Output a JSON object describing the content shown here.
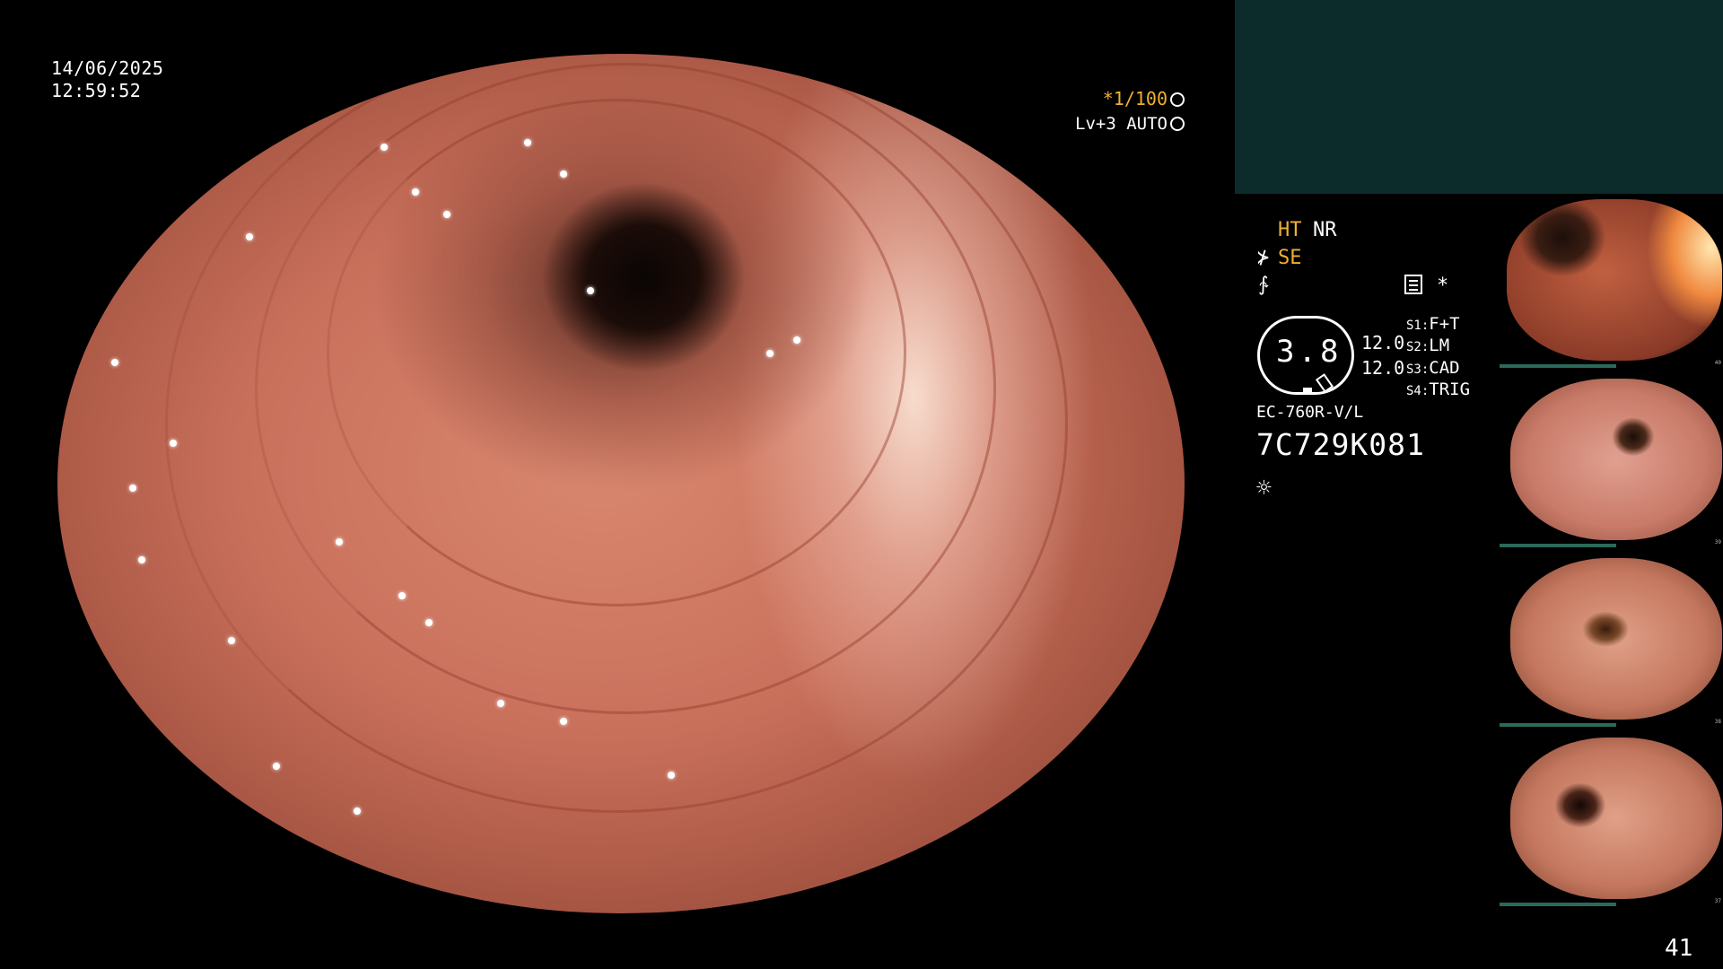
{
  "overlay": {
    "date": "14/06/2025",
    "time": "12:59:52",
    "zoom": "*1/100",
    "level": "Lv+3 AUTO"
  },
  "settings": {
    "ht": "HT",
    "nr": "NR",
    "se": "SE",
    "star": "*",
    "gauge_value": "3.8",
    "value_1": "12.0",
    "value_2": "12.0",
    "switches": [
      {
        "key": "S1:",
        "value": "F+T"
      },
      {
        "key": "S2:",
        "value": "LM"
      },
      {
        "key": "S3:",
        "value": "CAD"
      },
      {
        "key": "S4:",
        "value": "TRIG"
      }
    ]
  },
  "scope": {
    "model": "EC-760R-V/L",
    "serial": "7C729K081"
  },
  "icons": {
    "hook": "⊁",
    "freeze": "∱",
    "light": "☼",
    "zoom_icon": "aperture-icon",
    "level_icon": "iris-icon",
    "document": "document-icon"
  },
  "colors": {
    "accent": "#f0b030",
    "panel": "#0c2b2b"
  },
  "thumbnails": [
    {
      "num": "40"
    },
    {
      "num": "39"
    },
    {
      "num": "38"
    },
    {
      "num": "37"
    }
  ],
  "page_number": "41"
}
